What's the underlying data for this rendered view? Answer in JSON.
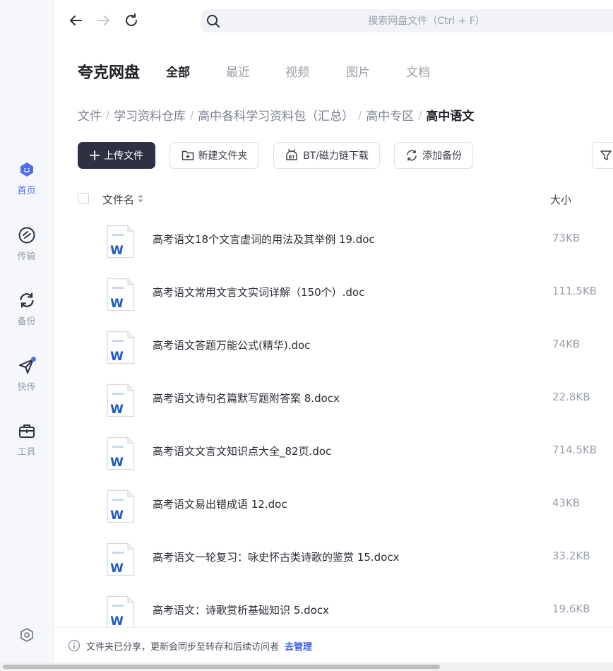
{
  "nav": {
    "search_placeholder": "搜索网盘文件（Ctrl + F）"
  },
  "rail": {
    "items": [
      {
        "label": "首页",
        "icon": "home-icon",
        "active": true
      },
      {
        "label": "传输",
        "icon": "transfer-icon"
      },
      {
        "label": "备份",
        "icon": "backup-icon"
      },
      {
        "label": "快传",
        "icon": "quick-send-icon"
      },
      {
        "label": "工具",
        "icon": "toolbox-icon"
      }
    ]
  },
  "header": {
    "brand": "夸克网盘",
    "tabs": [
      "全部",
      "最近",
      "视频",
      "图片",
      "文档"
    ],
    "active_tab": 0
  },
  "breadcrumb": [
    "文件",
    "学习资料仓库",
    "高中各科学习资料包（汇总）",
    "高中专区",
    "高中语文"
  ],
  "toolbar": {
    "upload": "上传文件",
    "new_folder": "新建文件夹",
    "bt_download": "BT/磁力链下载",
    "add_backup": "添加备份"
  },
  "table": {
    "col_name": "文件名",
    "col_size": "大小",
    "rows": [
      {
        "name": "高考语文18个文言虚词的用法及其举例 19.doc",
        "size": "73KB"
      },
      {
        "name": "高考语文常用文言文实词详解（150个）.doc",
        "size": "111.5KB"
      },
      {
        "name": "高考语文答题万能公式(精华).doc",
        "size": "74KB"
      },
      {
        "name": "高考语文诗句名篇默写题附答案 8.docx",
        "size": "22.8KB"
      },
      {
        "name": "高考语文文言文知识点大全_82页.doc",
        "size": "714.5KB"
      },
      {
        "name": "高考语文易出错成语 12.doc",
        "size": "43KB"
      },
      {
        "name": "高考语文一轮复习：咏史怀古类诗歌的鉴赏 15.docx",
        "size": "33.2KB"
      },
      {
        "name": "高考语文：诗歌赏析基础知识 5.docx",
        "size": "19.6KB"
      }
    ]
  },
  "notice": {
    "text": "文件夹已分享，更新会同步至转存和后续访问者",
    "action": "去管理"
  },
  "colors": {
    "accent": "#4f6cf0",
    "primary_button": "#2d3142",
    "word_blue": "#1e5bc6"
  }
}
